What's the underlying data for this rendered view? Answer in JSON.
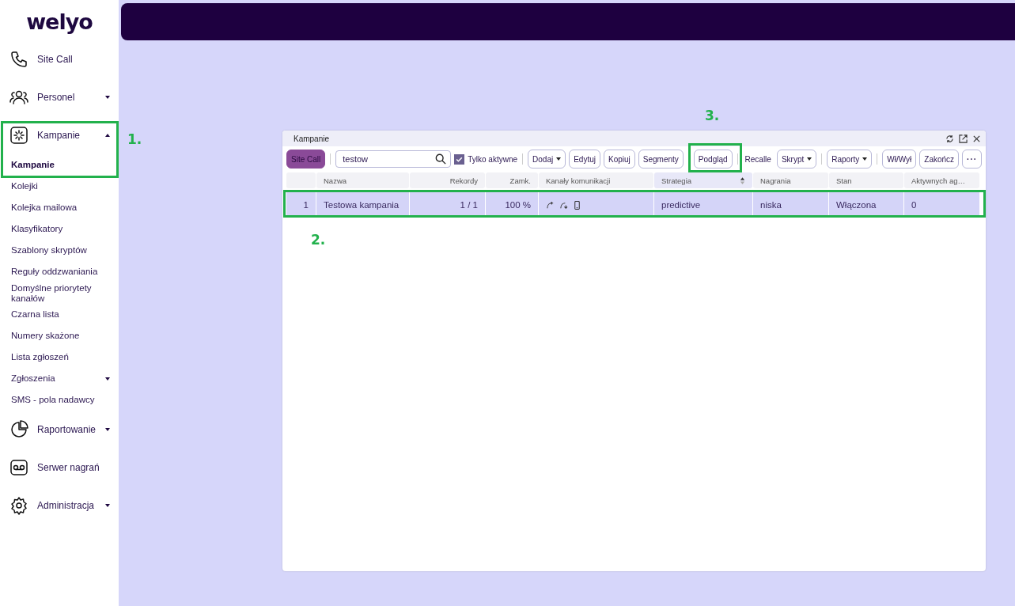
{
  "logo": "welyo",
  "nav": [
    {
      "label": "Site Call"
    },
    {
      "label": "Personel",
      "expanded": false
    },
    {
      "label": "Kampanie",
      "expanded": true,
      "children": [
        {
          "label": "Kampanie",
          "selected": true
        },
        {
          "label": "Kolejki",
          "selected": false
        },
        {
          "label": "Kolejka mailowa",
          "selected": false
        },
        {
          "label": "Klasyfikatory",
          "selected": false
        },
        {
          "label": "Szablony skryptów",
          "selected": false
        },
        {
          "label": "Reguły oddzwaniania",
          "selected": false
        },
        {
          "label": "Domyślne priorytety kanałów",
          "selected": false
        },
        {
          "label": "Czarna lista",
          "selected": false
        },
        {
          "label": "Numery skażone",
          "selected": false
        },
        {
          "label": "Lista zgłoszeń",
          "selected": false
        },
        {
          "label": "Zgłoszenia",
          "selected": false,
          "expanded": false
        },
        {
          "label": "SMS - pola nadawcy",
          "selected": false
        }
      ]
    },
    {
      "label": "Raportowanie",
      "expanded": false
    },
    {
      "label": "Serwer nagrań"
    },
    {
      "label": "Administracja",
      "expanded": false
    }
  ],
  "panel": {
    "title": "Kampanie",
    "toolbar": [
      {
        "kind": "primary",
        "label": "Site Call"
      },
      {
        "kind": "separator"
      },
      {
        "kind": "search",
        "value": "testow"
      },
      {
        "kind": "checkbox",
        "label": "Tylko aktywne",
        "checked": true
      },
      {
        "kind": "separator"
      },
      {
        "kind": "dropdown",
        "label": "Dodaj"
      },
      {
        "kind": "button",
        "label": "Edytuj"
      },
      {
        "kind": "button",
        "label": "Kopiuj"
      },
      {
        "kind": "button",
        "label": "Segmenty"
      },
      {
        "kind": "separator"
      },
      {
        "kind": "button",
        "label": "Podgląd"
      },
      {
        "kind": "separator"
      },
      {
        "kind": "plain",
        "label": "Recalle"
      },
      {
        "kind": "dropdown",
        "label": "Skrypt"
      },
      {
        "kind": "separator"
      },
      {
        "kind": "dropdown",
        "label": "Raporty"
      },
      {
        "kind": "separator"
      },
      {
        "kind": "button",
        "label": "Wł/Wył"
      },
      {
        "kind": "button",
        "label": "Zakończ"
      },
      {
        "kind": "more",
        "label": "···"
      }
    ],
    "columns": [
      {
        "selected": false
      },
      {
        "label": "Nazwa",
        "selected": false
      },
      {
        "label": "Rekordy",
        "selected": false
      },
      {
        "label": "Zamk.",
        "selected": false
      },
      {
        "label": "Kanały komunikacji",
        "selected": false
      },
      {
        "label": "Strategia",
        "selected": true
      },
      {
        "label": "Nagrania",
        "selected": false
      },
      {
        "label": "Stan",
        "selected": false
      },
      {
        "label": "Aktywnych ag…",
        "selected": false
      }
    ],
    "rows": [
      {
        "selected": true,
        "cells": [
          {
            "kind": "number",
            "text": "1"
          },
          {
            "kind": "text",
            "text": "Testowa kampania"
          },
          {
            "kind": "number",
            "text": "1 / 1"
          },
          {
            "kind": "number",
            "text": "100 %"
          },
          {
            "kind": "channels"
          },
          {
            "kind": "text",
            "text": "predictive"
          },
          {
            "kind": "text",
            "text": "niska"
          },
          {
            "kind": "text",
            "text": "Włączona"
          },
          {
            "kind": "text",
            "text": "0"
          }
        ]
      }
    ]
  },
  "annotations": [
    {
      "label": "1."
    },
    {
      "label": "2."
    },
    {
      "label": "3."
    }
  ]
}
